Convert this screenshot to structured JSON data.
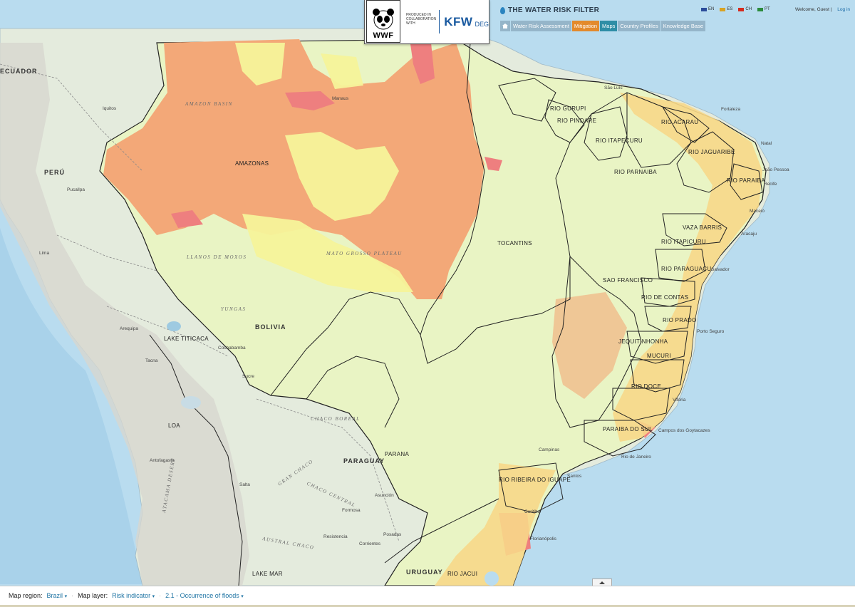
{
  "header": {
    "produced_text": "PRODUCED IN COLLABORATION WITH",
    "wwf_label": "WWF",
    "kfw_label": "KFW",
    "kfw_sub": "DEG",
    "site_title": "THE WATER RISK FILTER",
    "nav": [
      {
        "label": "Water Risk Assessment",
        "state": "default"
      },
      {
        "label": "Mitigation",
        "state": "orange"
      },
      {
        "label": "Maps",
        "state": "teal"
      },
      {
        "label": "Country Profiles",
        "state": "default"
      },
      {
        "label": "Knowledge Base",
        "state": "default"
      }
    ],
    "languages": [
      {
        "code": "EN",
        "flag_color": "#2b4c9a"
      },
      {
        "code": "ES",
        "flag_color": "#d9a322"
      },
      {
        "code": "CH",
        "flag_color": "#d52b1e"
      },
      {
        "code": "PT",
        "flag_color": "#2c8b3c"
      }
    ],
    "welcome": "Welcome, Guest",
    "login": "Log in"
  },
  "map": {
    "country_labels": [
      "PERÚ",
      "BOLIVIA",
      "PARAGUAY",
      "URUGUAY",
      "ECUADOR"
    ],
    "basin_labels": [
      "AMAZONAS",
      "TOCANTINS",
      "RIO GURUPI",
      "RIO PINDARE",
      "RIO ITAPECURU",
      "RIO PARNAIBA",
      "RIO ACARAU",
      "RIO JAGUARIBE",
      "RIO PARAIBA",
      "VAZA BARRIS",
      "RIO ITAPICURU",
      "RIO PARAGUACU",
      "SAO FRANCISCO",
      "RIO DE CONTAS",
      "RIO PRADO",
      "JEQUITINHONHA",
      "MUCURI",
      "RIO DOCE",
      "PARAIBA DO SUL",
      "PARANA",
      "RIO RIBEIRA DO IGUAPE",
      "RIO JACUI",
      "LAKE TITICACA",
      "LOA",
      "LAKE MAR"
    ],
    "place_labels": [
      "São Luís",
      "Fortaleza",
      "Natal",
      "João Pessoa",
      "Recife",
      "Maceió",
      "Aracaju",
      "Salvador",
      "Porto Seguro",
      "Vitória",
      "Campos dos Goytacazes",
      "Rio de Janeiro",
      "Santos",
      "Campinas",
      "Florianópolis",
      "Curitiba",
      "Asunción",
      "Posadas",
      "Corrientes",
      "Resistencia",
      "Formosa",
      "Salta",
      "Antofagasta",
      "Iquitos",
      "Pucallpa",
      "Cochabamba",
      "Sucre",
      "Tacna",
      "Arequipa",
      "Lima",
      "Manaus"
    ],
    "physical_labels": [
      "AMAZON BASIN",
      "LLANOS DE MOXOS",
      "MATO GROSSO PLATEAU",
      "YUNGAS",
      "CHACO BOREAL",
      "GRAN CHACO",
      "CHACO CENTRAL",
      "AUSTRAL CHACO",
      "ATACAMA DESERT"
    ],
    "risk_colors": {
      "very_low": "#e9f4c4",
      "low": "#f6f39a",
      "medium": "#f7d889",
      "high": "#f3a878",
      "very_high": "#ee7f7f"
    }
  },
  "footer": {
    "region_label": "Map region:",
    "region_value": "Brazil",
    "layer_label": "Map layer:",
    "layer_value": "Risk indicator",
    "indicator_value": "2.1 - Occurrence of floods"
  }
}
